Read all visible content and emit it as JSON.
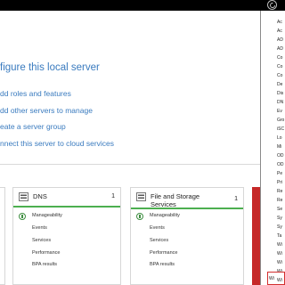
{
  "header": {
    "refresh_icon": "refresh-icon"
  },
  "welcome": {
    "heading": "figure this local server",
    "links": [
      "dd roles and features",
      "dd other servers to manage",
      "eate a server group",
      "nnect this server to cloud services"
    ]
  },
  "section_label": "1",
  "tiles": [
    {
      "title": "DNS",
      "count": "1",
      "rows": [
        "Manageability",
        "Events",
        "Services",
        "Performance",
        "BPA results"
      ]
    },
    {
      "title": "File and Storage Services",
      "count": "1",
      "rows": [
        "Manageability",
        "Events",
        "Services",
        "Performance",
        "BPA results"
      ]
    }
  ],
  "tools_menu": {
    "items": [
      "Ac",
      "Ac",
      "AD",
      "AD",
      "Co",
      "Co",
      "Co",
      "De",
      "Dis",
      "DN",
      "Ev",
      "Gro",
      "iSC",
      "Lo",
      "Mi",
      "OD",
      "OD",
      "Pe",
      "Pri",
      "Re",
      "Re",
      "Se",
      "Sy",
      "Sy",
      "Ta",
      "Wi",
      "Wi",
      "Wi",
      "Wi",
      "Wi",
      "Wi"
    ],
    "highlighted": "Wi"
  },
  "colors": {
    "link": "#3a7bbf",
    "status_ok": "#4caf50",
    "alert": "#c62828"
  }
}
